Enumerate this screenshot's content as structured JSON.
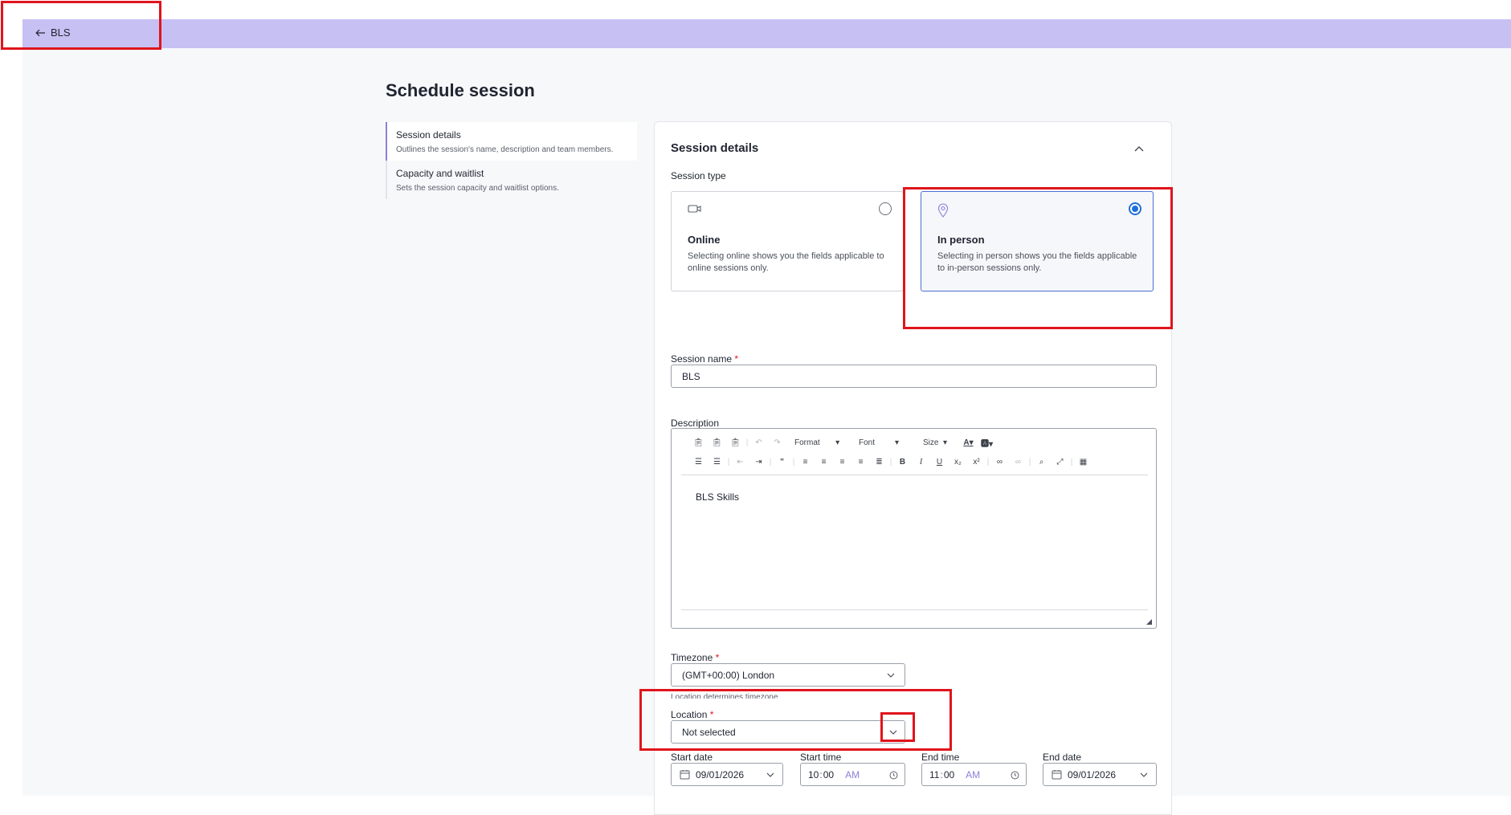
{
  "topbar": {
    "back_label": "BLS",
    "back_icon": "arrow-left-icon"
  },
  "page": {
    "title": "Schedule session"
  },
  "nav": {
    "items": [
      {
        "title": "Session details",
        "description": "Outlines the session's name, description and team members."
      },
      {
        "title": "Capacity and waitlist",
        "description": "Sets the session capacity and waitlist options."
      }
    ]
  },
  "card": {
    "title": "Session details",
    "session_type_label": "Session type",
    "types": [
      {
        "name": "Online",
        "description": "Selecting online shows you the fields applicable to online sessions only.",
        "selected": false,
        "icon": "video-camera-icon"
      },
      {
        "name": "In person",
        "description": "Selecting in person shows you the fields applicable to in-person sessions only.",
        "selected": true,
        "icon": "location-pin-icon"
      }
    ],
    "session_name_label": "Session name",
    "session_name_value": "BLS",
    "description_label": "Description",
    "editor": {
      "format_label": "Format",
      "font_label": "Font",
      "size_label": "Size",
      "content": "BLS Skills"
    },
    "timezone_label": "Timezone",
    "timezone_value": "(GMT+00:00) London",
    "location_hint": "Location determines timezone",
    "location_label": "Location",
    "location_value": "Not selected",
    "start_date_label": "Start date",
    "start_date_value": "09/01/2026",
    "start_time_label": "Start time",
    "start_time": {
      "hour": "10",
      "minute": "00",
      "period": "AM"
    },
    "end_time_label": "End time",
    "end_time": {
      "hour": "11",
      "minute": "00",
      "period": "AM"
    },
    "end_date_label": "End date",
    "end_date_value": "09/01/2026"
  },
  "colors": {
    "topbar": "#c7c0f2",
    "accent": "#1e6fd9",
    "highlight": "#e0141c",
    "period": "#8a7fd8"
  }
}
